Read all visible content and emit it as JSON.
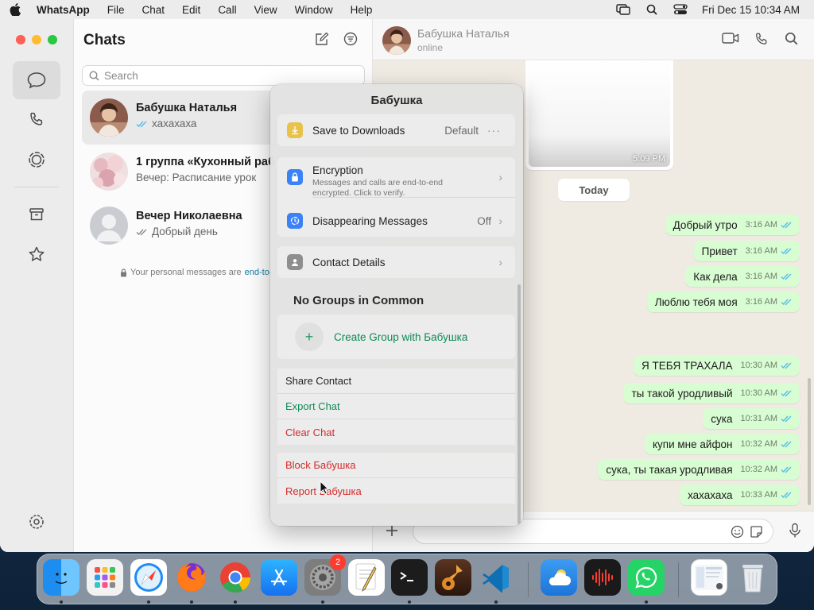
{
  "menubar": {
    "app": "WhatsApp",
    "items": [
      "File",
      "Chat",
      "Edit",
      "Call",
      "View",
      "Window",
      "Help"
    ],
    "datetime": "Fri Dec 15  10:34 AM"
  },
  "sidebar": {
    "title": "Chats",
    "search_placeholder": "Search",
    "chats": [
      {
        "name": "Бабушка Наталья",
        "preview": "хахахаха"
      },
      {
        "name": "1 группа «Кухонный раб",
        "preview": "Вечер:  Расписание урок"
      },
      {
        "name": "Вечер Николаевна",
        "preview": "Добрый день"
      }
    ],
    "encryption_note": "Your personal messages are",
    "encryption_link": "end-to-"
  },
  "conversation": {
    "contact_name": "Бабушка Наталья",
    "status": "online",
    "media_time": "5:09 PM",
    "day_label": "Today",
    "messages": [
      {
        "text": "Добрый утро",
        "time": "3:16 AM"
      },
      {
        "text": "Привет",
        "time": "3:16 AM"
      },
      {
        "text": "Как дела",
        "time": "3:16 AM"
      },
      {
        "text": "Люблю тебя моя",
        "time": "3:16 AM"
      },
      {
        "text": "Я ТЕБЯ ТРАХАЛА",
        "time": "10:30 AM"
      },
      {
        "text": "ты такой уродливый",
        "time": "10:30 AM"
      },
      {
        "text": "сука",
        "time": "10:31 AM"
      },
      {
        "text": "купи мне айфон",
        "time": "10:32 AM"
      },
      {
        "text": "сука, ты такая уродливая",
        "time": "10:32 AM"
      },
      {
        "text": "хахахаха",
        "time": "10:33 AM"
      }
    ]
  },
  "popover": {
    "title": "Бабушка",
    "save_to_downloads": {
      "label": "Save to Downloads",
      "value": "Default",
      "more": "···"
    },
    "encryption": {
      "label": "Encryption",
      "sub": "Messages and calls are end-to-end encrypted. Click to verify."
    },
    "disappearing": {
      "label": "Disappearing Messages",
      "value": "Off"
    },
    "contact_details": {
      "label": "Contact Details"
    },
    "groups_title": "No Groups in Common",
    "create_group": "Create Group with Бабушка",
    "share_contact": "Share Contact",
    "export_chat": "Export Chat",
    "clear_chat": "Clear Chat",
    "block": "Block Бабушка",
    "report": "Report Бабушка"
  },
  "dock": {
    "settings_badge": "2",
    "apps": [
      "finder-icon",
      "launchpad-icon",
      "safari-icon",
      "firefox-icon",
      "chrome-icon",
      "app-store-icon",
      "system-settings-icon",
      "textedit-icon",
      "terminal-icon",
      "garageband-icon",
      "vscode-icon",
      "weather-icon",
      "voice-memos-icon",
      "whatsapp-icon",
      "preview-icon",
      "trash-icon"
    ]
  },
  "colors": {
    "accent_green": "#0f8a54",
    "danger_red": "#d42a2a",
    "bubble_out": "#d9fdd3",
    "read_tick": "#53bdeb"
  }
}
